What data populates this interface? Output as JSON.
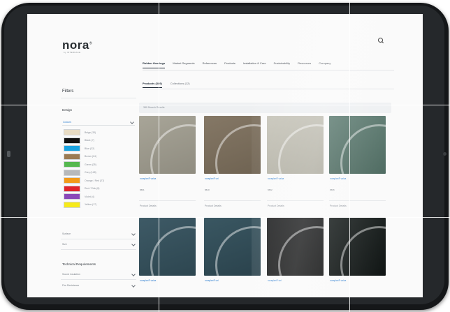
{
  "header": {
    "utility_links": [
      "",
      "",
      "",
      "",
      "",
      "",
      ""
    ],
    "logo_text": "nora",
    "logo_mark": "®",
    "logo_sub": "by INTERFACE",
    "search_icon": "search-icon"
  },
  "main_nav": {
    "items": [
      {
        "label": "Rubber floorings",
        "active": true
      },
      {
        "label": "Market Segments"
      },
      {
        "label": "References"
      },
      {
        "label": "Products"
      },
      {
        "label": "Installation & Care"
      },
      {
        "label": "Sustainability"
      },
      {
        "label": "Resources"
      },
      {
        "label": "Company"
      }
    ]
  },
  "sub_tabs": [
    {
      "label": "Products (389)",
      "active": true
    },
    {
      "label": "Collections (12)"
    }
  ],
  "results_text": "389 Search Results",
  "filters": {
    "title": "Filters",
    "colour_group": {
      "title": "Design",
      "selected": "Colours",
      "swatches": [
        {
          "label": "Beige (33)",
          "color": "#e8dcc4"
        },
        {
          "label": "Black (7)",
          "color": "#111111"
        },
        {
          "label": "Blue (32)",
          "color": "#1aa3e0"
        },
        {
          "label": "Brown (24)",
          "color": "#9b7a52"
        },
        {
          "label": "Green (25)",
          "color": "#55b84f"
        },
        {
          "label": "Grey (148)",
          "color": "#b7b9bb"
        },
        {
          "label": "Orange / Red (27)",
          "color": "#f29a1a"
        },
        {
          "label": "Red / Pink (8)",
          "color": "#e0242c"
        },
        {
          "label": "Violet (4)",
          "color": "#8a48b8"
        },
        {
          "label": "Yellow (17)",
          "color": "#f6ea1a"
        }
      ]
    },
    "collapsed_groups": [
      "Surface",
      "Size"
    ],
    "technical_title": "Technical Requirements",
    "technical_rows": [
      "Sound insulation",
      "Fire Resistance"
    ]
  },
  "products": [
    {
      "name": "noraplan® valua",
      "number": "6601",
      "detail": "Product Details",
      "color": "#a8a598",
      "color2": "#8f8c80"
    },
    {
      "name": "noraplan® uni",
      "number": "6610",
      "detail": "Product Details",
      "color": "#857866",
      "color2": "#6f6352"
    },
    {
      "name": "noraplan® valua",
      "number": "6602",
      "detail": "Product Details",
      "color": "#c8c6bb",
      "color2": "#b0ae a2"
    },
    {
      "name": "noraplan® valua",
      "number": "6606",
      "detail": "Product Details",
      "color": "#5f7d73",
      "color2": "#4a675d"
    },
    {
      "name": "noraplan® valua",
      "number": "",
      "detail": "",
      "color": "#3e5a66",
      "color2": "#2d4650"
    },
    {
      "name": "noraplan® uni",
      "number": "",
      "detail": "",
      "color": "#3a5762",
      "color2": "#2a424c"
    },
    {
      "name": "noraplan® uni",
      "number": "",
      "detail": "",
      "color": "#222324",
      "color2": "#171818"
    },
    {
      "name": "noraplan® valua",
      "number": "",
      "detail": "",
      "color": "#1d2322",
      "color2": "#111615"
    }
  ]
}
